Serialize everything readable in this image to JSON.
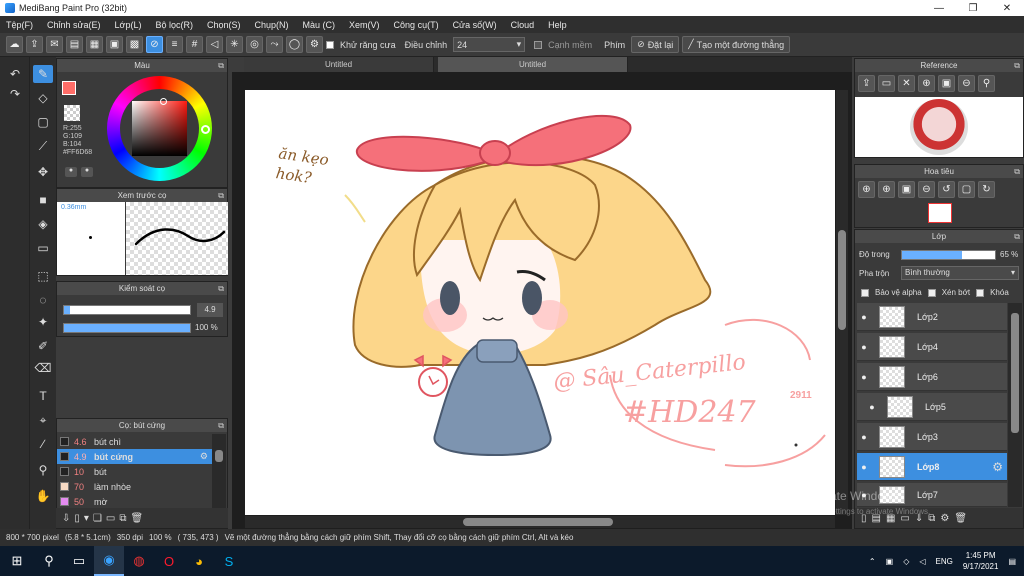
{
  "title": "MediBang Paint Pro (32bit)",
  "menu": [
    "Tệp(F)",
    "Chỉnh sửa(E)",
    "Lớp(L)",
    "Bộ lọc(R)",
    "Chọn(S)",
    "Chụp(N)",
    "Màu (C)",
    "Xem(V)",
    "Công cụ(T)",
    "Cửa số(W)",
    "Cloud",
    "Help"
  ],
  "toolbar": {
    "antialias_label": "Khử răng cưa",
    "correction_label": "Điều chỉnh",
    "correction_value": "24",
    "edge_label": "Cạnh mềm",
    "brush_label": "Phím",
    "reset_label": "Đặt lại",
    "line_label": "Tạo một đường thẳng"
  },
  "tabs": [
    "Untitled",
    "Untitled"
  ],
  "color_panel": {
    "title": "Màu",
    "r": "R:255",
    "g": "G:109",
    "b": "B:104",
    "hex": "#FF6D68",
    "primary": "#ff6d68"
  },
  "brush_preview": {
    "title": "Xem trước cọ",
    "size": "0.36mm"
  },
  "brush_control": {
    "title": "Kiểm soát cọ",
    "size": "4.9",
    "opacity": "100 %",
    "size_frac": 0.05,
    "opacity_frac": 1.0
  },
  "brush_list": {
    "title": "Cọ: bút cứng",
    "items": [
      {
        "size": "4.6",
        "name": "bút chì",
        "color": "#222222"
      },
      {
        "size": "4.9",
        "name": "bút cứng",
        "color": "#222222"
      },
      {
        "size": "10",
        "name": "bút",
        "color": "#222222"
      },
      {
        "size": "70",
        "name": "làm nhòe",
        "color": "#f5d9c3"
      },
      {
        "size": "50",
        "name": "mờ",
        "color": "#e48cf0"
      }
    ]
  },
  "reference": {
    "title": "Reference"
  },
  "navigator": {
    "title": "Hoa tiêu"
  },
  "layer_panel": {
    "title": "Lớp",
    "opacity_label": "Độ trong",
    "opacity_value": "65 %",
    "opacity_frac": 0.65,
    "blend_label": "Pha trộn",
    "blend_value": "Bình thường",
    "protect_alpha": "Bảo vệ alpha",
    "clipping": "Xén bớt",
    "lock": "Khóa",
    "layers": [
      "Lớp2",
      "Lớp4",
      "Lớp6",
      "Lớp5",
      "Lớp3",
      "Lớp8",
      "Lớp7"
    ]
  },
  "canvas_text": {
    "question": "ăn kẹo hok?",
    "sig": "@ Sâu_Caterpillo",
    "year": "2911",
    "tag": "#HD247"
  },
  "status": {
    "size": "800 * 700 pixel",
    "cm": "(5.8 * 5.1cm)",
    "dpi": "350 dpi",
    "zoom": "100 %",
    "coords": "( 735, 473 )",
    "hint": "Vẽ một đường thẳng bằng cách giữ phím Shift, Thay đổi cỡ cọ bằng cách giữ phím Ctrl, Alt và kéo"
  },
  "watermark": {
    "line1": "Activate Windows",
    "line2": "Go to Settings to activate Windows."
  },
  "taskbar": {
    "time": "1:45 PM",
    "date": "9/17/2021",
    "lang": "ENG"
  }
}
